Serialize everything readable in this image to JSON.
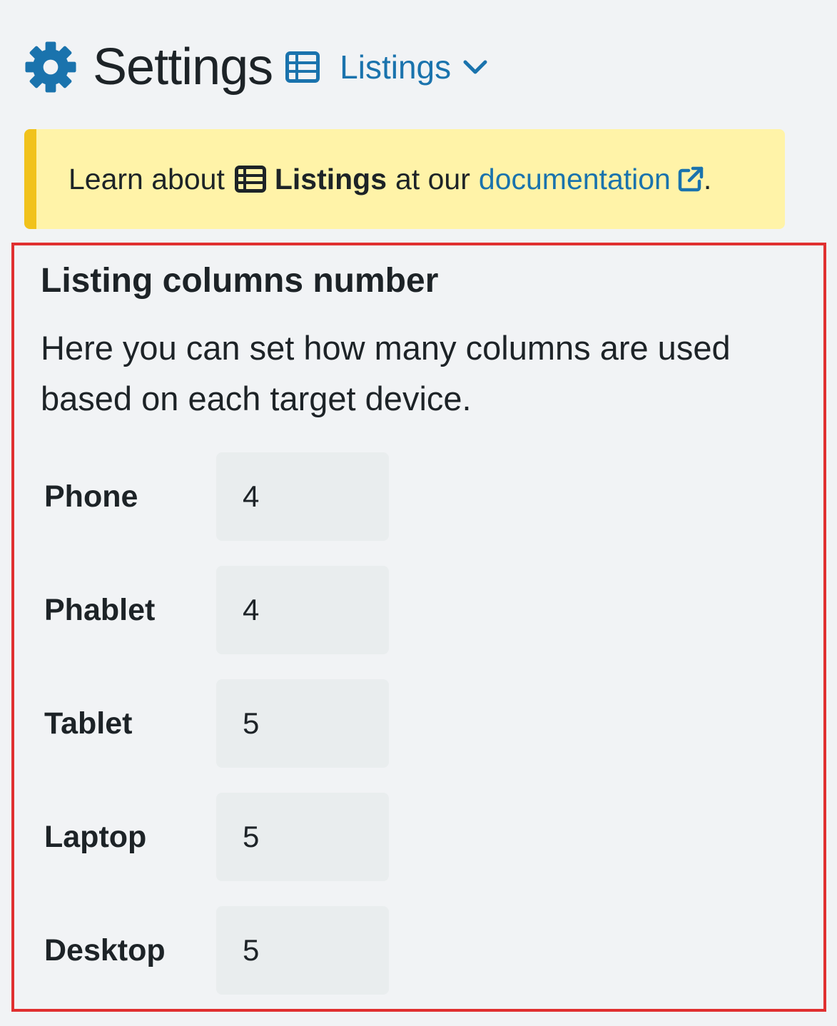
{
  "header": {
    "title": "Settings",
    "title_icon": "gear-icon",
    "section_icon": "list-icon",
    "dropdown_label": "Listings",
    "dropdown_icon": "chevron-down-icon"
  },
  "notice": {
    "prefix": "Learn about",
    "strong": "Listings",
    "middle": "at our",
    "link_text": "documentation",
    "suffix": ".",
    "link_icon": "external-link-icon"
  },
  "section": {
    "title": "Listing columns number",
    "description": "Here you can set how many columns are used based on each target device.",
    "rows": [
      {
        "label": "Phone",
        "value": "4"
      },
      {
        "label": "Phablet",
        "value": "4"
      },
      {
        "label": "Tablet",
        "value": "5"
      },
      {
        "label": "Laptop",
        "value": "5"
      },
      {
        "label": "Desktop",
        "value": "5"
      }
    ]
  },
  "colors": {
    "accent": "#1a73ad",
    "notice_bg": "#fff3a8",
    "notice_border": "#f1c21b",
    "highlight_border": "#e03030"
  }
}
